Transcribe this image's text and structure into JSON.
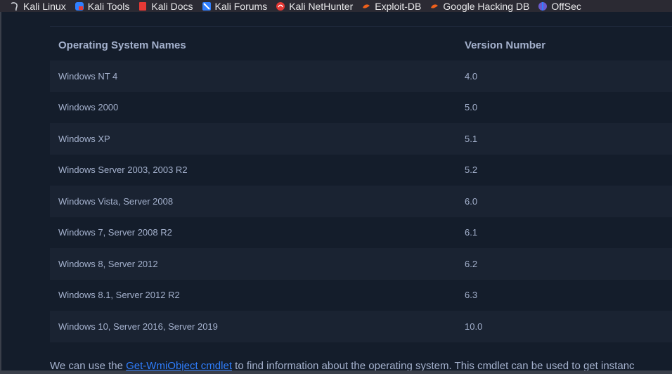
{
  "bookmarks": [
    {
      "label": "Kali Linux",
      "icon": "kali-dragon-icon",
      "color": "#cfd3da"
    },
    {
      "label": "Kali Tools",
      "icon": "kali-tools-icon",
      "color": "#2f7fff"
    },
    {
      "label": "Kali Docs",
      "icon": "kali-docs-icon",
      "color": "#e53935"
    },
    {
      "label": "Kali Forums",
      "icon": "kali-forums-icon",
      "color": "#2f7fff"
    },
    {
      "label": "Kali NetHunter",
      "icon": "kali-nethunter-icon",
      "color": "#e53935"
    },
    {
      "label": "Exploit-DB",
      "icon": "exploit-db-icon",
      "color": "#f0601a"
    },
    {
      "label": "Google Hacking DB",
      "icon": "google-hacking-db-icon",
      "color": "#f0601a"
    },
    {
      "label": "OffSec",
      "icon": "offsec-icon",
      "color": "#6a5acd"
    }
  ],
  "table": {
    "headers": [
      "Operating System Names",
      "Version Number"
    ],
    "rows": [
      [
        "Windows NT 4",
        "4.0"
      ],
      [
        "Windows 2000",
        "5.0"
      ],
      [
        "Windows XP",
        "5.1"
      ],
      [
        "Windows Server 2003, 2003 R2",
        "5.2"
      ],
      [
        "Windows Vista, Server 2008",
        "6.0"
      ],
      [
        "Windows 7, Server 2008 R2",
        "6.1"
      ],
      [
        "Windows 8, Server 2012",
        "6.2"
      ],
      [
        "Windows 8.1, Server 2012 R2",
        "6.3"
      ],
      [
        "Windows 10, Server 2016, Server 2019",
        "10.0"
      ]
    ]
  },
  "footer": {
    "prefix": "We can use the ",
    "link": "Get-WmiObject cmdlet",
    "suffix": " to find information about the operating system. This cmdlet can be used to get instanc"
  }
}
